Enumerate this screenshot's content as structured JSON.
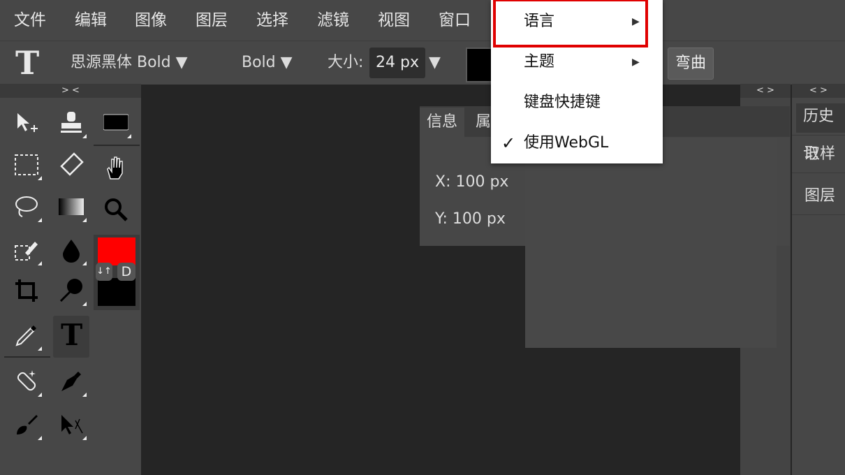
{
  "menubar": {
    "items": [
      "文件",
      "编辑",
      "图像",
      "图层",
      "选择",
      "滤镜",
      "视图",
      "窗口"
    ]
  },
  "options": {
    "tool_icon": "T",
    "font_family": "思源黑体 Bold ▼",
    "font_weight": "Bold ▼",
    "size_label": "大小:",
    "size_value": "24 px",
    "size_arrow": "▼",
    "warp_button": "弯曲"
  },
  "strips": {
    "toolbox_toggle": "> <",
    "dock1_toggle": "< >",
    "dock2_toggle": "< >"
  },
  "colors": {
    "foreground": "#ff0000",
    "background": "#000000",
    "swap_label": "↓↑",
    "default_label": "D"
  },
  "info_panel": {
    "tab_info": "信息",
    "tab_properties": "属",
    "x_value": "X: 100 px",
    "y_value": "Y: 100 px"
  },
  "dock": {
    "tab_history": "历史记",
    "tab_sample": "取样",
    "tab_layers": "图层"
  },
  "dropdown": {
    "items": [
      {
        "label": "语言",
        "arrow": "▶"
      },
      {
        "label": "主题",
        "arrow": "▶"
      },
      {
        "label": "键盘快捷键"
      },
      {
        "label": "使用WebGL",
        "check": "✓"
      }
    ]
  }
}
